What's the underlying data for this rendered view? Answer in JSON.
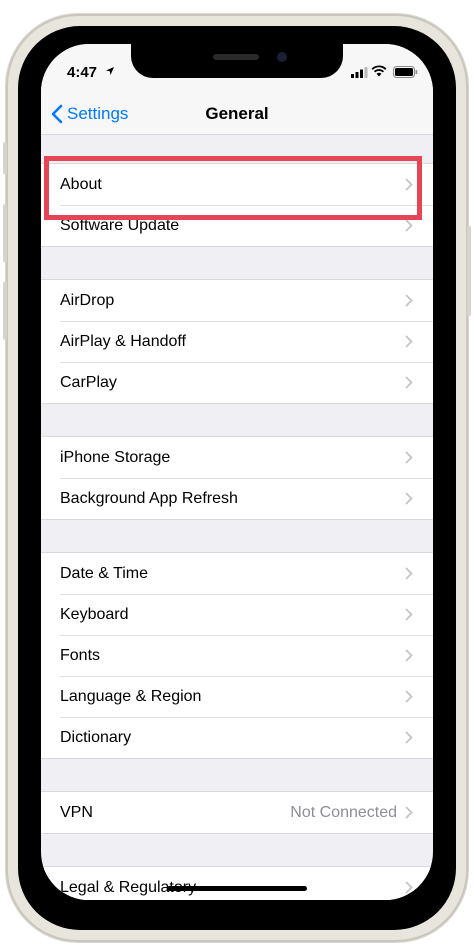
{
  "status_bar": {
    "time": "4:47",
    "icons": [
      "location-arrow-icon",
      "cellular-signal-icon",
      "wifi-icon",
      "battery-icon"
    ]
  },
  "nav": {
    "back_label": "Settings",
    "title": "General"
  },
  "groups": [
    {
      "rows": [
        {
          "label": "About"
        },
        {
          "label": "Software Update"
        }
      ]
    },
    {
      "rows": [
        {
          "label": "AirDrop"
        },
        {
          "label": "AirPlay & Handoff"
        },
        {
          "label": "CarPlay"
        }
      ]
    },
    {
      "rows": [
        {
          "label": "iPhone Storage"
        },
        {
          "label": "Background App Refresh"
        }
      ]
    },
    {
      "rows": [
        {
          "label": "Date & Time"
        },
        {
          "label": "Keyboard"
        },
        {
          "label": "Fonts"
        },
        {
          "label": "Language & Region"
        },
        {
          "label": "Dictionary"
        }
      ]
    },
    {
      "rows": [
        {
          "label": "VPN",
          "value": "Not Connected"
        }
      ]
    },
    {
      "rows": [
        {
          "label": "Legal & Regulatory"
        }
      ]
    }
  ],
  "colors": {
    "accent": "#007aff",
    "highlight": "#e64553",
    "background": "#efeff4",
    "secondary_text": "#8e8e93"
  }
}
